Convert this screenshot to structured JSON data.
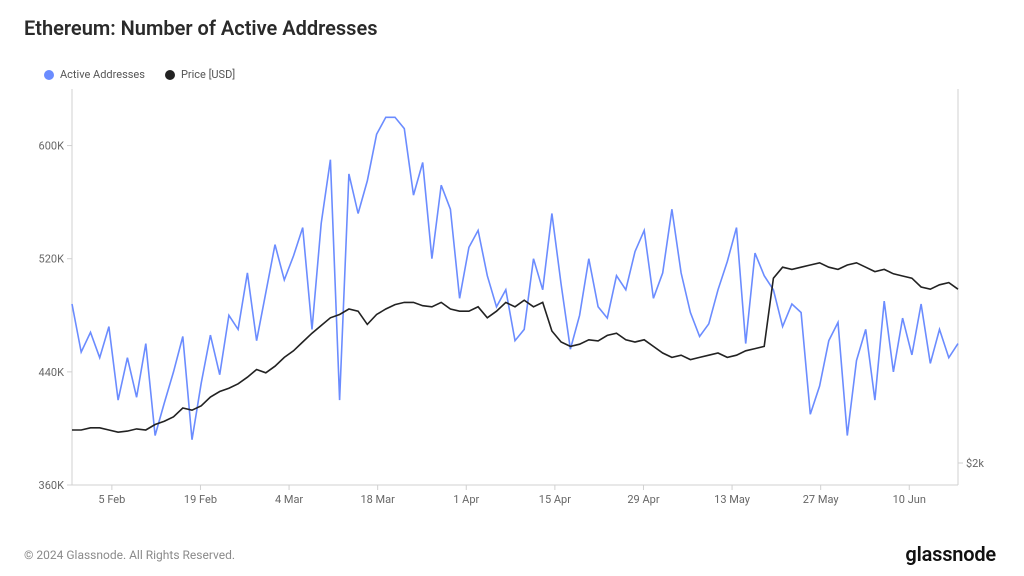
{
  "title": "Ethereum: Number of Active Addresses",
  "legend": {
    "series1": "Active Addresses",
    "series2": "Price [USD]"
  },
  "footer": "© 2024 Glassnode. All Rights Reserved.",
  "brand": "glassnode",
  "colors": {
    "active": "#6b8cff",
    "price": "#222222",
    "grid": "#e8e8e8",
    "axis": "#cfcfcf",
    "tick": "#666666"
  },
  "chart_data": {
    "type": "line",
    "xlabel": "",
    "ylabel_left": "",
    "ylabel_right": "",
    "x_ticks": [
      "5 Feb",
      "19 Feb",
      "4 Mar",
      "18 Mar",
      "1 Apr",
      "15 Apr",
      "29 Apr",
      "13 May",
      "27 May",
      "10 Jun"
    ],
    "y_left_ticks": [
      "360K",
      "440K",
      "520K",
      "600K"
    ],
    "y_left_range": [
      360000,
      640000
    ],
    "y_right_ticks": [
      "$2k"
    ],
    "y_right_range": [
      1800,
      5400
    ],
    "series": [
      {
        "name": "Active Addresses",
        "axis": "left",
        "values": [
          488000,
          454000,
          468000,
          450000,
          472000,
          420000,
          450000,
          422000,
          460000,
          395000,
          418000,
          440000,
          465000,
          392000,
          432000,
          466000,
          438000,
          480000,
          470000,
          510000,
          462000,
          496000,
          530000,
          505000,
          522000,
          542000,
          470000,
          545000,
          590000,
          420000,
          580000,
          552000,
          575000,
          608000,
          620000,
          620000,
          612000,
          565000,
          588000,
          520000,
          572000,
          555000,
          492000,
          528000,
          540000,
          508000,
          486000,
          498000,
          462000,
          470000,
          520000,
          498000,
          552000,
          502000,
          456000,
          480000,
          520000,
          486000,
          478000,
          508000,
          498000,
          525000,
          540000,
          492000,
          510000,
          555000,
          510000,
          482000,
          465000,
          474000,
          498000,
          518000,
          542000,
          460000,
          524000,
          508000,
          498000,
          472000,
          488000,
          482000,
          410000,
          430000,
          462000,
          475000,
          395000,
          448000,
          470000,
          420000,
          490000,
          440000,
          478000,
          452000,
          488000,
          446000,
          470000,
          450000,
          460000
        ]
      },
      {
        "name": "Price [USD]",
        "axis": "right",
        "values": [
          2300,
          2300,
          2320,
          2320,
          2300,
          2280,
          2290,
          2310,
          2300,
          2350,
          2380,
          2420,
          2500,
          2480,
          2520,
          2600,
          2650,
          2680,
          2720,
          2780,
          2850,
          2820,
          2880,
          2960,
          3020,
          3100,
          3180,
          3250,
          3320,
          3350,
          3400,
          3380,
          3260,
          3350,
          3400,
          3440,
          3460,
          3460,
          3430,
          3420,
          3460,
          3400,
          3380,
          3380,
          3420,
          3320,
          3380,
          3460,
          3420,
          3480,
          3420,
          3460,
          3200,
          3100,
          3060,
          3080,
          3120,
          3110,
          3160,
          3180,
          3120,
          3100,
          3120,
          3060,
          3000,
          2960,
          2980,
          2940,
          2960,
          2980,
          3000,
          2960,
          2980,
          3020,
          3040,
          3060,
          3680,
          3780,
          3760,
          3780,
          3800,
          3820,
          3780,
          3760,
          3800,
          3820,
          3780,
          3740,
          3760,
          3720,
          3700,
          3680,
          3600,
          3580,
          3620,
          3640,
          3580
        ]
      }
    ]
  }
}
